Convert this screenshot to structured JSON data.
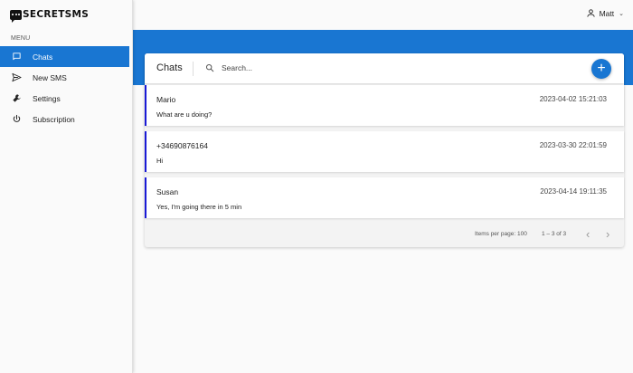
{
  "app": {
    "brand": "SECRETSMS"
  },
  "sidebar": {
    "menu_label": "MENU",
    "items": [
      {
        "label": "Chats",
        "icon": "chat-bubble-icon",
        "active": true
      },
      {
        "label": "New SMS",
        "icon": "send-icon",
        "active": false
      },
      {
        "label": "Settings",
        "icon": "wrench-icon",
        "active": false
      },
      {
        "label": "Subscription",
        "icon": "power-icon",
        "active": false
      }
    ]
  },
  "topbar": {
    "user_name": "Matt"
  },
  "main": {
    "title": "Chats",
    "search_placeholder": "Search...",
    "add_label": "+",
    "chats": [
      {
        "name": "Mario",
        "time": "2023-04-02 15:21:03",
        "message": "What are u doing?"
      },
      {
        "name": "+34690876164",
        "time": "2023-03-30 22:01:59",
        "message": "Hi"
      },
      {
        "name": "Susan",
        "time": "2023-04-14 19:11:35",
        "message": "Yes, I'm going there in 5 min"
      }
    ],
    "paginator": {
      "items_per_page_label": "Items per page:",
      "items_per_page": "100",
      "range": "1 – 3 of 3"
    }
  },
  "colors": {
    "primary": "#1976d2",
    "chat_accent": "#1a1ad6",
    "background": "#fafafa"
  }
}
